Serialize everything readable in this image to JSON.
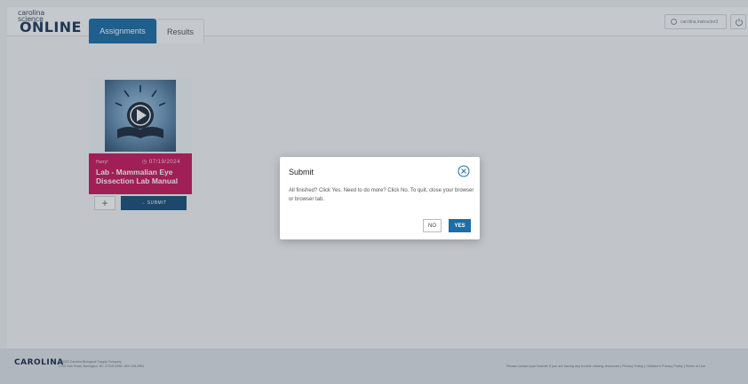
{
  "header": {
    "logo_small": "carolina\nscience",
    "logo_main": "ONLINE",
    "tabs": [
      {
        "label": "Assignments",
        "active": true
      },
      {
        "label": "Results",
        "active": false
      }
    ],
    "user": {
      "label": "carolina instructor3",
      "icon": "user-icon"
    },
    "power_icon": "power-icon"
  },
  "card": {
    "thumbnail_icon": "play-book-icon",
    "status": "Hurry!",
    "due_date": "07/19/2024",
    "title": "Lab - Mammalian Eye Dissection Lab Manual",
    "add_label": "+",
    "submit_label": "→ SUBMIT"
  },
  "modal": {
    "title": "Submit",
    "body": "All finished? Click Yes. Need to do more? Click No. To quit, close your browser or browser tab.",
    "no_label": "NO",
    "yes_label": "YES"
  },
  "footer": {
    "logo": "CAROLINA",
    "copyright_line1": "© 2023 Carolina Biological Supply Company",
    "copyright_line2": "2700 York Road, Burlington, NC 27215-3398 • 800.334.5551",
    "links": "Please contact your teacher if you are having any trouble viewing resources | Privacy Policy | Children's Privacy Policy | Terms of Use"
  },
  "colors": {
    "primary": "#1b6ea8",
    "card_band": "#c8185e",
    "submit": "#1b4f7a"
  }
}
